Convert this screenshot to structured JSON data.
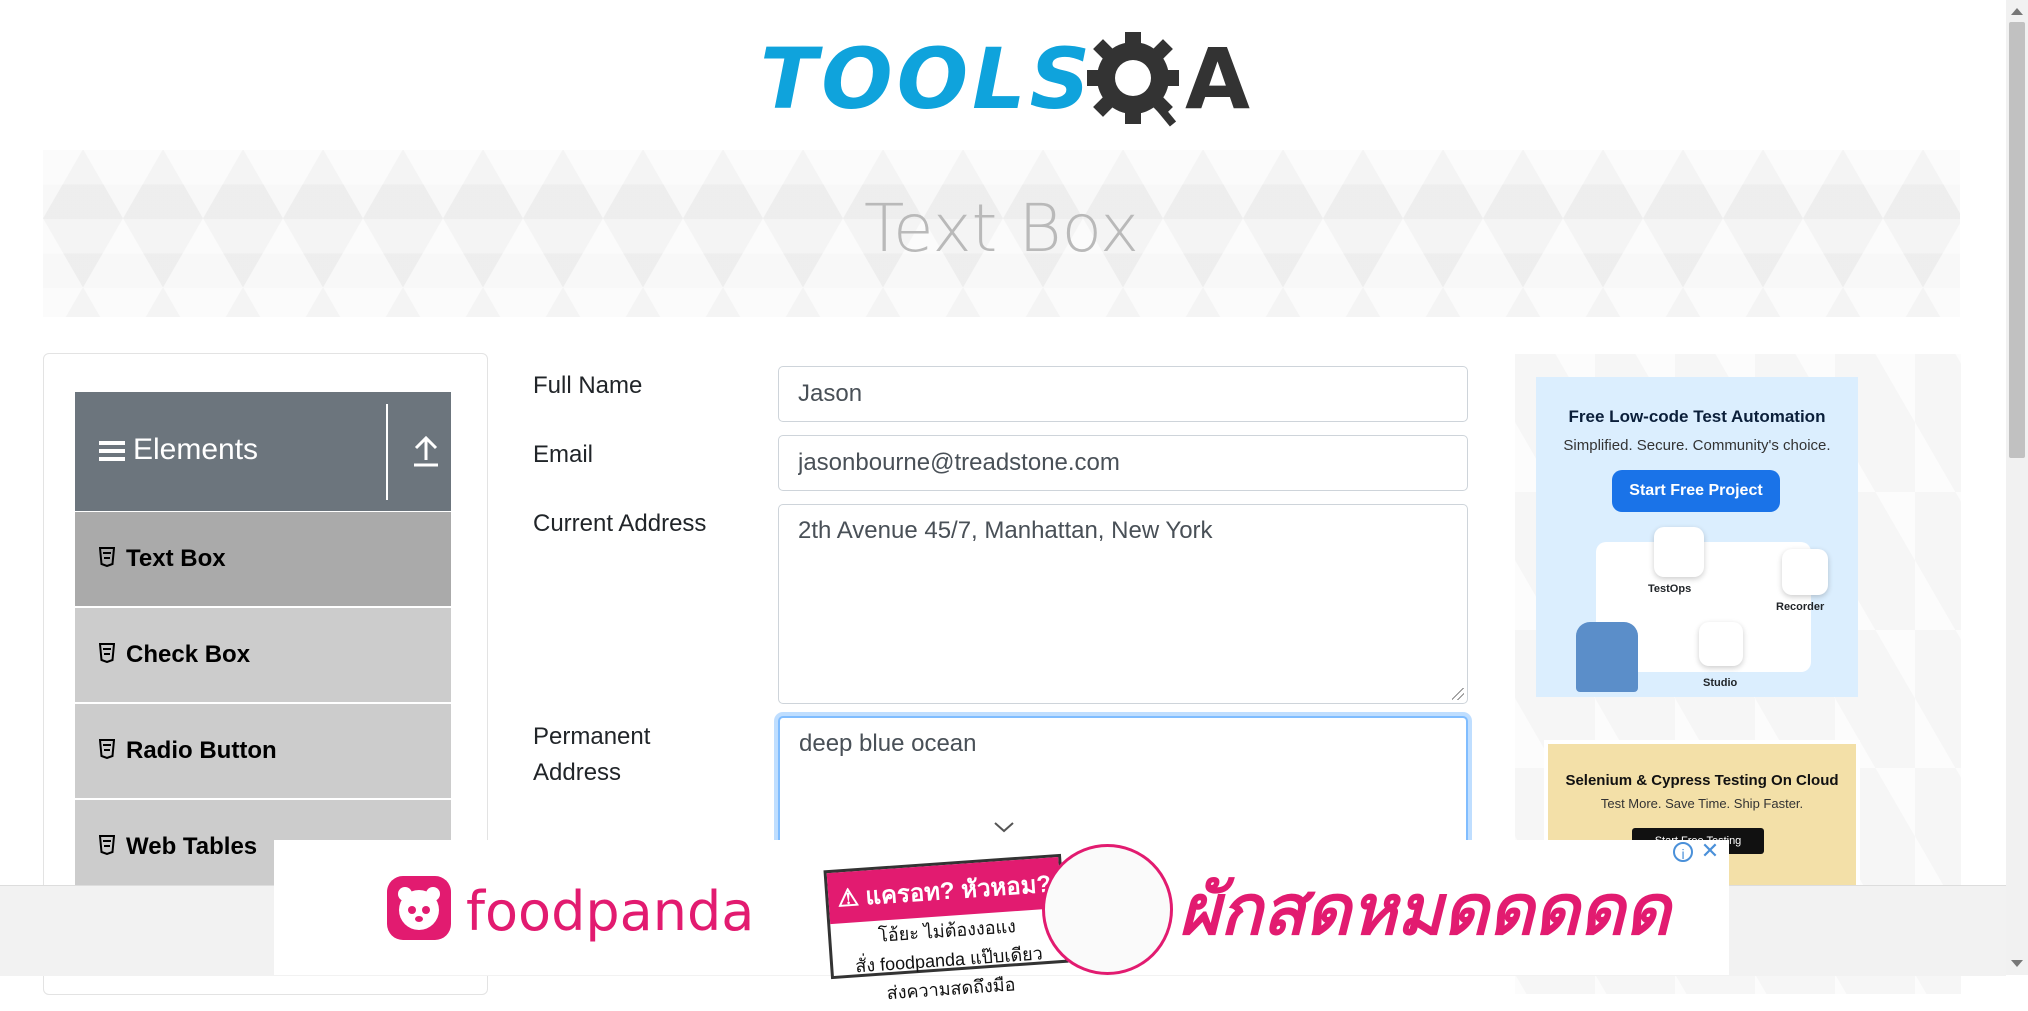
{
  "logo": {
    "text": "TOOLS",
    "suffix": "QA"
  },
  "banner": {
    "title": "Text Box"
  },
  "sidebar": {
    "group_title": "Elements",
    "items": [
      {
        "label": "Text Box"
      },
      {
        "label": "Check Box"
      },
      {
        "label": "Radio Button"
      },
      {
        "label": "Web Tables"
      }
    ]
  },
  "form": {
    "full_name": {
      "label": "Full Name",
      "value": "Jason"
    },
    "email": {
      "label": "Email",
      "value": "jasonbourne@treadstone.com"
    },
    "current_address": {
      "label": "Current Address",
      "value": "2th Avenue 45/7, Manhattan, New York"
    },
    "permanent_address": {
      "label_line1": "Permanent",
      "label_line2": "Address",
      "value": "deep blue ocean"
    }
  },
  "ads": {
    "ad1": {
      "title": "Free Low-code Test Automation",
      "subtitle": "Simplified. Secure. Community's choice.",
      "button": "Start Free Project",
      "tiles": [
        "TestOps",
        "Recorder",
        "Studio"
      ]
    },
    "ad2": {
      "title": "Selenium & Cypress Testing On Cloud",
      "subtitle": "Test More. Save Time. Ship Faster.",
      "button": "Start Free Testing"
    },
    "bottom": {
      "brand": "foodpanda",
      "sign_title": "⚠ แครอท? หัวหอม?",
      "sign_line1": "โอ้ยะ ไม่ต้องงอแง",
      "sign_line2": "สั่ง foodpanda แป๊บเดียว",
      "sign_line3": "ส่งความสดถึงมือ",
      "slogan": "ผักสดหมดดดดด",
      "info": "i",
      "close": "✕"
    }
  },
  "colors": {
    "brand_blue": "#0fa3dc",
    "sidebar_header": "#6c757d",
    "active_item": "#aaaaaa",
    "foodpanda_pink": "#e21b70",
    "focus_border": "#80bdff"
  }
}
